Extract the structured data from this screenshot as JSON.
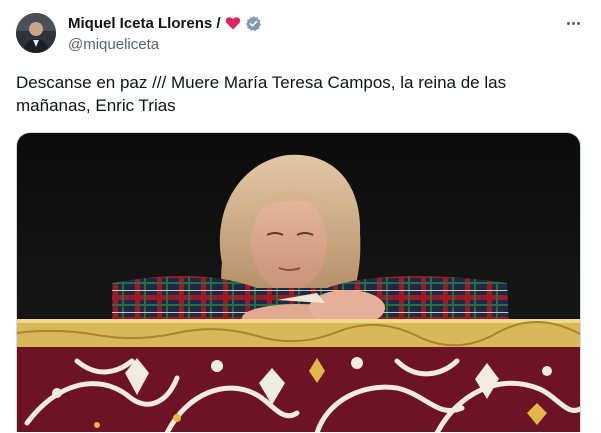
{
  "author": {
    "name": "Miquel Iceta Llorens /",
    "handle": "@miqueliceta",
    "name_icons": [
      "heart-icon",
      "verified-badge-icon"
    ],
    "avatar_icon": "avatar"
  },
  "menu": {
    "icon": "more-options-icon"
  },
  "tweet": {
    "text": "Descanse en paz /// Muere María Teresa Campos, la reina de las mañanas, Enric Trias"
  },
  "media": {
    "type": "photo"
  },
  "colors": {
    "text": "#0f1419",
    "secondary": "#536471",
    "heart": "#e0245e",
    "verified": "#829aab",
    "banner_red": "#6e1226",
    "banner_gold": "#d9b85a"
  }
}
